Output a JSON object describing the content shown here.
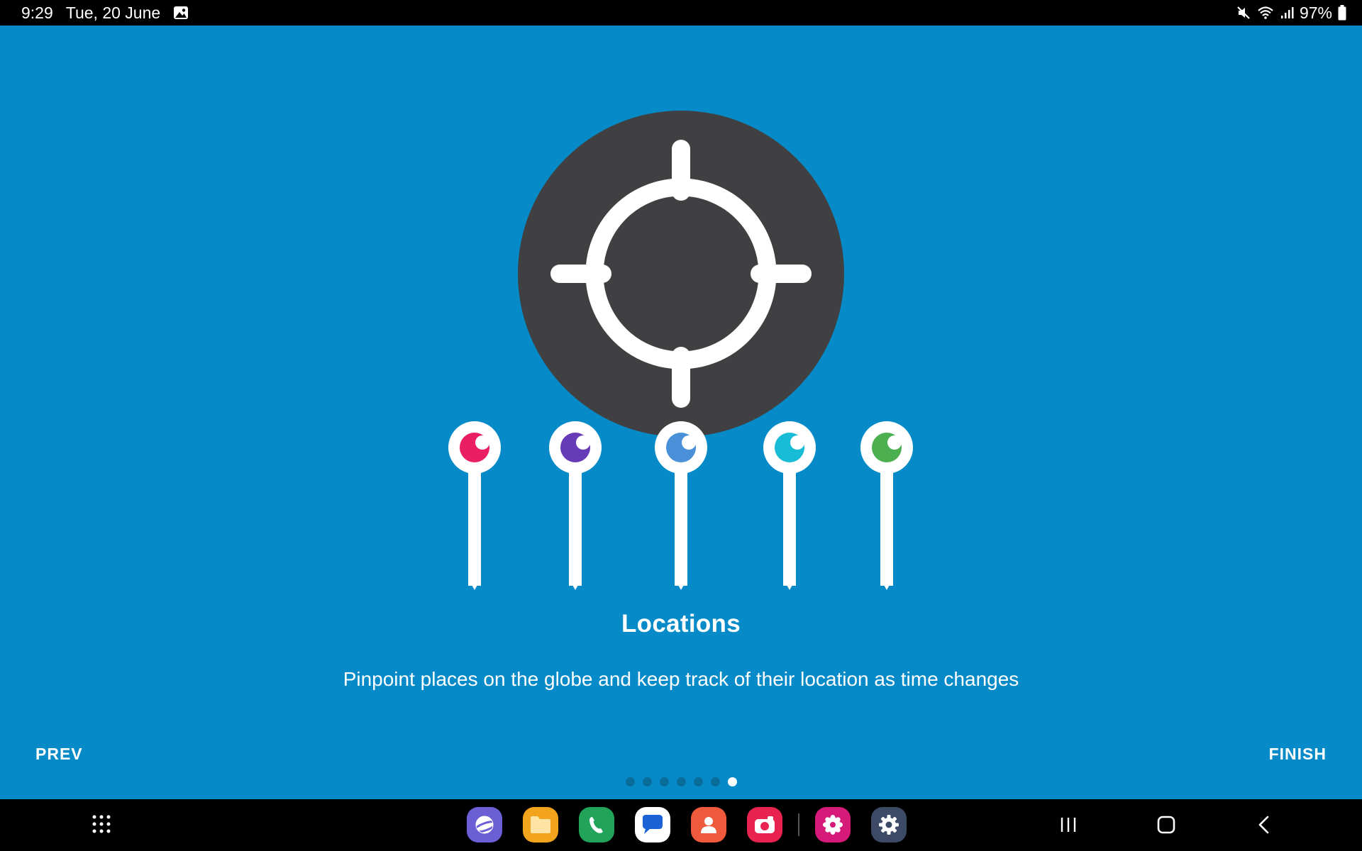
{
  "status_bar": {
    "time": "9:29",
    "date": "Tue, 20 June",
    "battery": "97%",
    "icons": [
      "gallery-icon",
      "mute-icon",
      "wifi-icon",
      "signal-icon",
      "battery-icon"
    ]
  },
  "onboarding": {
    "title": "Locations",
    "description": "Pinpoint places on the globe and keep track of their location as time changes",
    "prev_label": "PREV",
    "finish_label": "FINISH",
    "page_count": 7,
    "current_page": 7
  },
  "colors": {
    "background": "#068bc8",
    "circle": "#404042",
    "pins": [
      "#e91e63",
      "#673ab7",
      "#4a90d9",
      "#18bcd6",
      "#4caf50"
    ]
  },
  "dock": {
    "apps": [
      "internet-icon",
      "my-files-icon",
      "phone-icon",
      "messages-icon",
      "contacts-icon",
      "camera-icon",
      "gallery-app-icon",
      "settings-icon"
    ]
  },
  "nav_buttons": [
    "recent-apps-icon",
    "home-icon",
    "back-icon"
  ]
}
